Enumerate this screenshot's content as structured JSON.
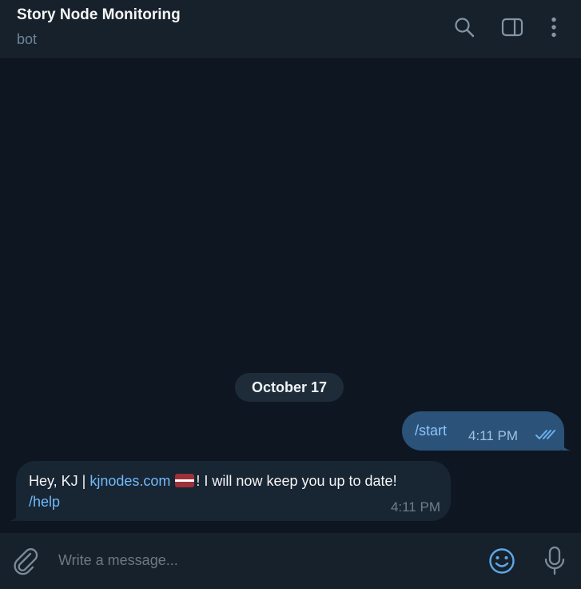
{
  "header": {
    "title": "Story Node Monitoring",
    "subtitle": "bot",
    "icons": [
      "search-icon",
      "sidebar-toggle-icon",
      "more-vertical-icon"
    ]
  },
  "messages": {
    "date_separator": "October 17",
    "outgoing": {
      "text": "/start",
      "time": "4:11 PM",
      "status": "read"
    },
    "incoming": {
      "prefix": "Hey, KJ | ",
      "link": "kjnodes.com",
      "flag": "latvia-flag",
      "suffix": "! I will now keep you up to date!",
      "command": "/help",
      "time": "4:11 PM"
    }
  },
  "composer": {
    "placeholder": "Write a message...",
    "icons": [
      "paperclip-icon",
      "emoji-icon",
      "microphone-icon"
    ]
  },
  "colors": {
    "background": "#0e1621",
    "panel": "#17212b",
    "outgoing_bubble": "#2b5278",
    "incoming_bubble": "#182533",
    "accent": "#71baf9"
  }
}
